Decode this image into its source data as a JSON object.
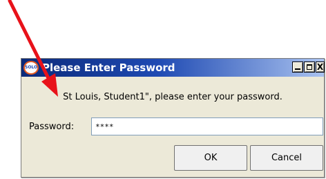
{
  "window": {
    "title": "Please Enter Password",
    "app_icon_text": "SOLO",
    "close_glyph": "X"
  },
  "dialog": {
    "message": "St Louis, Student1\", please enter your password.",
    "password_label": "Password:",
    "password_value": "****",
    "ok_label": "OK",
    "cancel_label": "Cancel"
  },
  "annotation": {
    "arrow_color": "#e8121a",
    "arrow_icon": "red-arrow"
  },
  "colors": {
    "titlebar_dark": "#0b2a7a",
    "titlebar_light": "#a9c2ef",
    "dialog_bg": "#ece9d8"
  }
}
